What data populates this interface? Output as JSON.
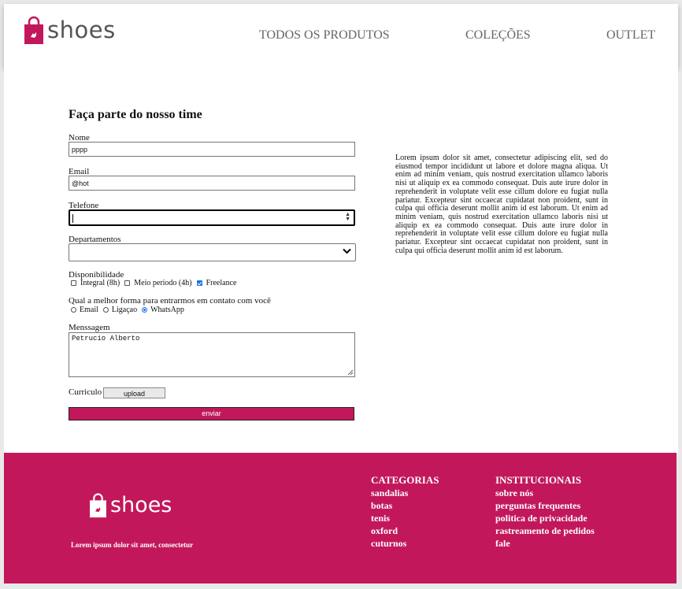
{
  "brand": {
    "name": "shoes"
  },
  "nav": [
    "TODOS OS PRODUTOS",
    "COLEÇÕES",
    "OUTLET"
  ],
  "form": {
    "title": "Faça parte do nosso time",
    "name_label": "Nome",
    "name_value": "pppp",
    "email_label": "Email",
    "email_value": "@hot",
    "phone_label": "Telefone",
    "phone_value": "",
    "dept_label": "Departamentos",
    "dept_value": "",
    "avail_label": "Disponibilidade",
    "avail_options": [
      {
        "label": "Integral (8h)",
        "checked": false
      },
      {
        "label": "Meio periodo (4h)",
        "checked": false
      },
      {
        "label": "Freelance",
        "checked": true
      }
    ],
    "contact_label": "Qual a melhor forma para entrarmos em contato com você",
    "contact_options": [
      {
        "label": "Email",
        "checked": false
      },
      {
        "label": "Ligaçao",
        "checked": false
      },
      {
        "label": "WhatsApp",
        "checked": true
      }
    ],
    "message_label": "Menssagem",
    "message_value": "Petrucio Alberto",
    "cv_label": "Curriculo",
    "upload_label": "upload",
    "submit_label": "enviar"
  },
  "lorem": "Lorem ipsum dolor sit amet, consectetur adipiscing elit, sed do eiusmod tempor incididunt ut labore et dolore magna aliqua. Ut enim ad minim veniam, quis nostrud exercitation ullamco laboris nisi ut aliquip ex ea commodo consequat. Duis aute irure dolor in reprehenderit in voluptate velit esse cillum dolore eu fugiat nulla pariatur. Excepteur sint occaecat cupidatat non proident, sunt in culpa qui officia deserunt mollit anim id est laborum. Ut enim ad minim veniam, quis nostrud exercitation ullamco laboris nisi ut aliquip ex ea commodo consequat. Duis aute irure dolor in reprehenderit in voluptate velit esse cillum dolore eu fugiat nulla pariatur. Excepteur sint occaecat cupidatat non proident, sunt in culpa qui officia deserunt mollit anim id est laborum.",
  "footer": {
    "tagline": "Lorem ipsum dolor sit amet, consectetur",
    "categorias": {
      "title": "CATEGORIAS",
      "items": [
        "sandalias",
        "botas",
        "tenis",
        "oxford",
        "cuturnos"
      ]
    },
    "institucionais": {
      "title": "INSTITUCIONAIS",
      "items": [
        "sobre nós",
        "perguntas frequentes",
        "politica de privacidade",
        "rastreamento de pedidos",
        "fale"
      ]
    }
  },
  "colors": {
    "brand": "#c2185b",
    "nav_text": "#666666",
    "checkbox": "#1a73e8"
  }
}
